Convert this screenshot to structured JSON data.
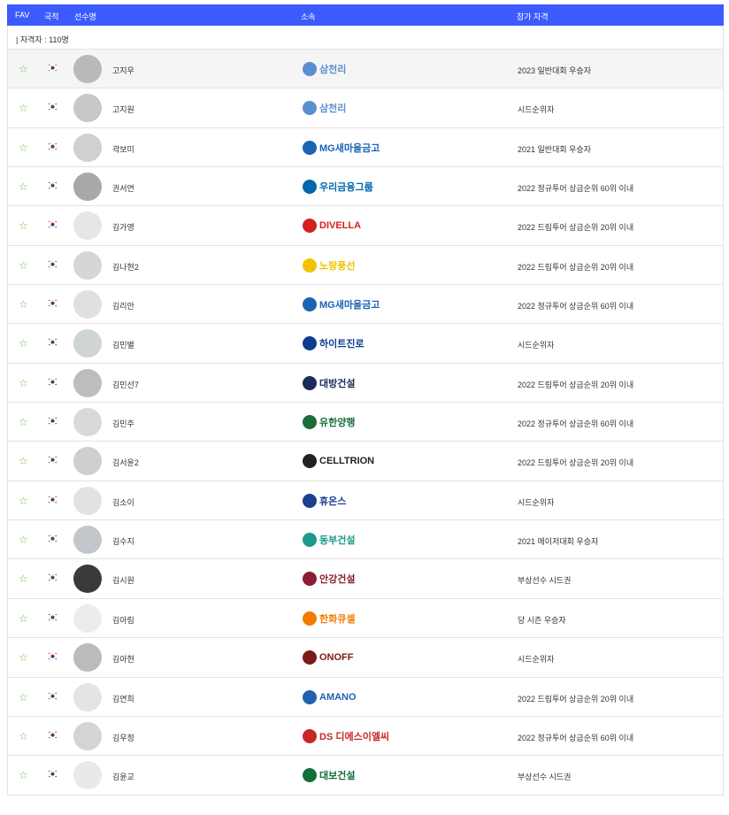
{
  "header": {
    "fav": "FAV",
    "country": "국적",
    "player": "선수명",
    "team": "소속",
    "qualification": "참가 자격"
  },
  "count_text": "| 자격자 : 110명",
  "players": [
    {
      "name": "고지우",
      "team": "삼천리",
      "team_color": "#5a8fd0",
      "qual": "2023 일반대회 우승자",
      "avatar": "#b9b9b9"
    },
    {
      "name": "고지원",
      "team": "삼천리",
      "team_color": "#5a8fd0",
      "qual": "시드순위자",
      "avatar": "#c8c8c8"
    },
    {
      "name": "곽보미",
      "team": "MG새마을금고",
      "team_color": "#1b63b5",
      "qual": "2021 일반대회 우승자",
      "avatar": "#d0d0d0"
    },
    {
      "name": "권서연",
      "team": "우리금융그룹",
      "team_color": "#0067ac",
      "qual": "2022 정규투어 상금순위 60위 이내",
      "avatar": "#a8a8a8"
    },
    {
      "name": "김가영",
      "team": "DIVELLA",
      "team_color": "#d3201f",
      "qual": "2022 드림투어 상금순위 20위 이내",
      "avatar": "#e6e6e6"
    },
    {
      "name": "김나현2",
      "team": "노랑풍선",
      "team_color": "#f2c200",
      "qual": "2022 드림투어 상금순위 20위 이내",
      "avatar": "#d6d6d6"
    },
    {
      "name": "김리안",
      "team": "MG새마을금고",
      "team_color": "#1b63b5",
      "qual": "2022 정규투어 상금순위 60위 이내",
      "avatar": "#e0e0e0"
    },
    {
      "name": "김민별",
      "team": "하이트진로",
      "team_color": "#0b3d91",
      "qual": "시드순위자",
      "avatar": "#cfd6d2"
    },
    {
      "name": "김민선7",
      "team": "대방건설",
      "team_color": "#1d2b5a",
      "qual": "2022 드림투어 상금순위 20위 이내",
      "avatar": "#bdbdbd"
    },
    {
      "name": "김민주",
      "team": "유한양행",
      "team_color": "#1a6d3a",
      "qual": "2022 정규투어 상금순위 60위 이내",
      "avatar": "#d9d9d9"
    },
    {
      "name": "김서윤2",
      "team": "CELLTRION",
      "team_color": "#222222",
      "qual": "2022 드림투어 상금순위 20위 이내",
      "avatar": "#cfcfcf"
    },
    {
      "name": "김소이",
      "team": "휴온스",
      "team_color": "#1c3f8f",
      "qual": "시드순위자",
      "avatar": "#e2e2e2"
    },
    {
      "name": "김수지",
      "team": "동부건설",
      "team_color": "#1c9a8a",
      "qual": "2021 메이저대회 우승자",
      "avatar": "#c3c7cc"
    },
    {
      "name": "김시원",
      "team": "안강건설",
      "team_color": "#8b1e34",
      "qual": "부상선수 시드권",
      "avatar": "#3a3a3a"
    },
    {
      "name": "김아림",
      "team": "한화큐셀",
      "team_color": "#f07c00",
      "qual": "당 시즌 우승자",
      "avatar": "#ececec"
    },
    {
      "name": "김아현",
      "team": "ONOFF",
      "team_color": "#7a1a1a",
      "qual": "시드순위자",
      "avatar": "#bbbbbb"
    },
    {
      "name": "김연희",
      "team": "AMANO",
      "team_color": "#2061b0",
      "qual": "2022 드림투어 상금순위 20위 이내",
      "avatar": "#e4e4e4"
    },
    {
      "name": "김우정",
      "team": "DS 디에스이엘씨",
      "team_color": "#c62828",
      "qual": "2022 정규투어 상금순위 60위 이내",
      "avatar": "#d4d4d4"
    },
    {
      "name": "김윤교",
      "team": "대보건설",
      "team_color": "#11703a",
      "qual": "부상선수 시드권",
      "avatar": "#e9e9e9"
    }
  ]
}
